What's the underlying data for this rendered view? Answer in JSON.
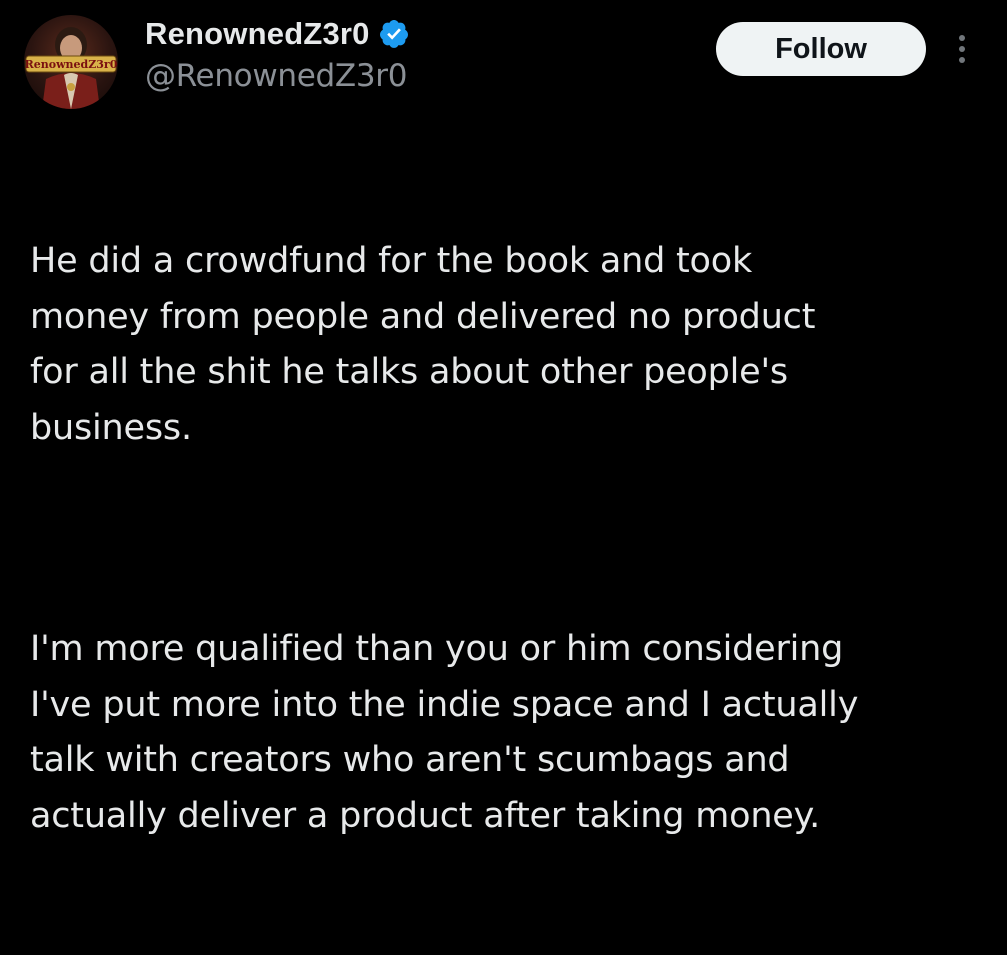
{
  "author": {
    "display_name": "RenownedZ3r0",
    "handle": "@RenownedZ3r0",
    "verified": true,
    "avatar_banner_text": "RenownedZ3r0"
  },
  "actions": {
    "follow_label": "Follow"
  },
  "tweet": {
    "paragraphs": [
      "He did a crowdfund for the book and took\nmoney from people and delivered no product\nfor all the shit he talks about other people's\nbusiness.",
      "I'm more qualified than you or him considering\nI've put more into the indie space and I actually\ntalk with creators who aren't scumbags and\nactually deliver a product after taking money."
    ]
  },
  "icons": {
    "verified": "verified-badge-icon",
    "more": "more-options-icon"
  },
  "colors": {
    "background": "#000000",
    "text_primary": "#e7e9ea",
    "text_secondary": "#8b9096",
    "verified_blue": "#1d9bf0",
    "follow_bg": "#eff3f4",
    "follow_text": "#0f1419"
  }
}
